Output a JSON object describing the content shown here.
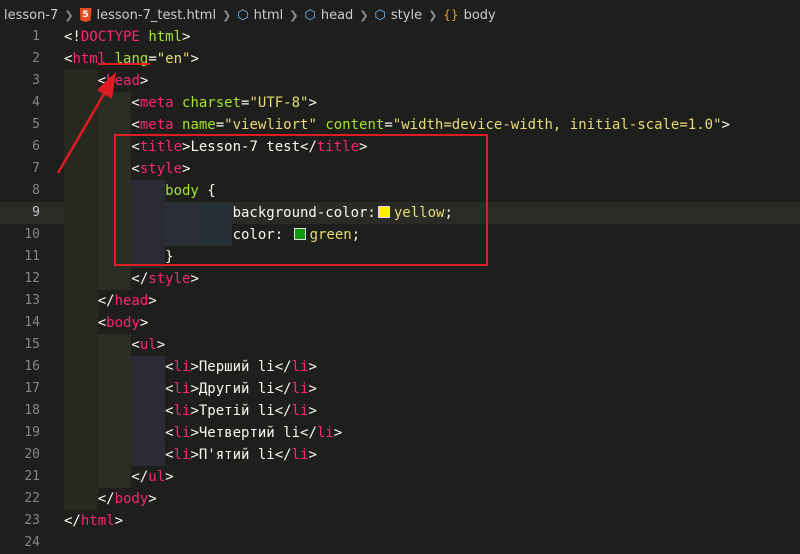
{
  "breadcrumb": {
    "items": [
      "lesson-7",
      "lesson-7_test.html",
      "html",
      "head",
      "style",
      "body"
    ],
    "html5_icon_letter": "5"
  },
  "editor": {
    "active_line": 9,
    "lines": [
      {
        "n": "1",
        "t": [
          [
            "br",
            "<!"
          ],
          [
            "tag",
            "DOCTYPE"
          ],
          [
            "br",
            " "
          ],
          [
            "attr",
            "html"
          ],
          [
            "br",
            ">"
          ]
        ]
      },
      {
        "n": "2",
        "t": [
          [
            "br",
            "<"
          ],
          [
            "tag",
            "html"
          ],
          [
            "br",
            " "
          ],
          [
            "attr",
            "lang"
          ],
          [
            "br",
            "="
          ],
          [
            "str",
            "\"en\""
          ],
          [
            "br",
            ">"
          ]
        ]
      },
      {
        "n": "3",
        "t": [
          [
            "br",
            "    <"
          ],
          [
            "tag",
            "head"
          ],
          [
            "br",
            ">"
          ]
        ]
      },
      {
        "n": "4",
        "t": [
          [
            "br",
            "        <"
          ],
          [
            "tag",
            "meta"
          ],
          [
            "br",
            " "
          ],
          [
            "attr",
            "charset"
          ],
          [
            "br",
            "="
          ],
          [
            "str",
            "\"UTF-8\""
          ],
          [
            "br",
            ">"
          ]
        ]
      },
      {
        "n": "5",
        "t": [
          [
            "br",
            "        <"
          ],
          [
            "tag",
            "meta"
          ],
          [
            "br",
            " "
          ],
          [
            "attr",
            "name"
          ],
          [
            "br",
            "="
          ],
          [
            "str",
            "\"viewliort\""
          ],
          [
            "br",
            " "
          ],
          [
            "attr",
            "content"
          ],
          [
            "br",
            "="
          ],
          [
            "str",
            "\"width=device-width, initial-scale=1.0\""
          ],
          [
            "br",
            ">"
          ]
        ]
      },
      {
        "n": "6",
        "t": [
          [
            "br",
            "        <"
          ],
          [
            "tag",
            "title"
          ],
          [
            "br",
            ">Lesson-7 test</"
          ],
          [
            "tag",
            "title"
          ],
          [
            "br",
            ">"
          ]
        ]
      },
      {
        "n": "7",
        "t": [
          [
            "br",
            "        <"
          ],
          [
            "tag",
            "style"
          ],
          [
            "br",
            ">"
          ]
        ]
      },
      {
        "n": "8",
        "t": [
          [
            "sel",
            "            body"
          ],
          [
            "br",
            " {"
          ]
        ]
      },
      {
        "n": "9",
        "t": [
          [
            "prop",
            "                    background-color:"
          ],
          [
            "swatch",
            "#ffee00"
          ],
          [
            "val",
            "yellow"
          ],
          [
            "br",
            ";"
          ]
        ]
      },
      {
        "n": "10",
        "t": [
          [
            "prop",
            "                    color: "
          ],
          [
            "swatch",
            "#119911"
          ],
          [
            "val",
            "green"
          ],
          [
            "br",
            ";"
          ]
        ]
      },
      {
        "n": "11",
        "t": [
          [
            "br",
            "            }"
          ]
        ]
      },
      {
        "n": "12",
        "t": [
          [
            "br",
            "        </"
          ],
          [
            "tag",
            "style"
          ],
          [
            "br",
            ">"
          ]
        ]
      },
      {
        "n": "13",
        "t": [
          [
            "br",
            "    </"
          ],
          [
            "tag",
            "head"
          ],
          [
            "br",
            ">"
          ]
        ]
      },
      {
        "n": "14",
        "t": [
          [
            "br",
            "    <"
          ],
          [
            "tag",
            "body"
          ],
          [
            "br",
            ">"
          ]
        ]
      },
      {
        "n": "15",
        "t": [
          [
            "br",
            "        <"
          ],
          [
            "tag",
            "ul"
          ],
          [
            "br",
            ">"
          ]
        ]
      },
      {
        "n": "16",
        "t": [
          [
            "br",
            "            <"
          ],
          [
            "tag",
            "li"
          ],
          [
            "br",
            ">Перший li</"
          ],
          [
            "tag",
            "li"
          ],
          [
            "br",
            ">"
          ]
        ]
      },
      {
        "n": "17",
        "t": [
          [
            "br",
            "            <"
          ],
          [
            "tag",
            "li"
          ],
          [
            "br",
            ">Другий li</"
          ],
          [
            "tag",
            "li"
          ],
          [
            "br",
            ">"
          ]
        ]
      },
      {
        "n": "18",
        "t": [
          [
            "br",
            "            <"
          ],
          [
            "tag",
            "li"
          ],
          [
            "br",
            ">Третій li</"
          ],
          [
            "tag",
            "li"
          ],
          [
            "br",
            ">"
          ]
        ]
      },
      {
        "n": "19",
        "t": [
          [
            "br",
            "            <"
          ],
          [
            "tag",
            "li"
          ],
          [
            "br",
            ">Четвертий li</"
          ],
          [
            "tag",
            "li"
          ],
          [
            "br",
            ">"
          ]
        ]
      },
      {
        "n": "20",
        "t": [
          [
            "br",
            "            <"
          ],
          [
            "tag",
            "li"
          ],
          [
            "br",
            ">П'ятий li</"
          ],
          [
            "tag",
            "li"
          ],
          [
            "br",
            ">"
          ]
        ]
      },
      {
        "n": "21",
        "t": [
          [
            "br",
            "        </"
          ],
          [
            "tag",
            "ul"
          ],
          [
            "br",
            ">"
          ]
        ]
      },
      {
        "n": "22",
        "t": [
          [
            "br",
            "    </"
          ],
          [
            "tag",
            "body"
          ],
          [
            "br",
            ">"
          ]
        ]
      },
      {
        "n": "23",
        "t": [
          [
            "br",
            "</"
          ],
          [
            "tag",
            "html"
          ],
          [
            "br",
            ">"
          ]
        ]
      },
      {
        "n": "24",
        "t": []
      }
    ]
  },
  "annotation": {
    "color": "#e11b22"
  }
}
